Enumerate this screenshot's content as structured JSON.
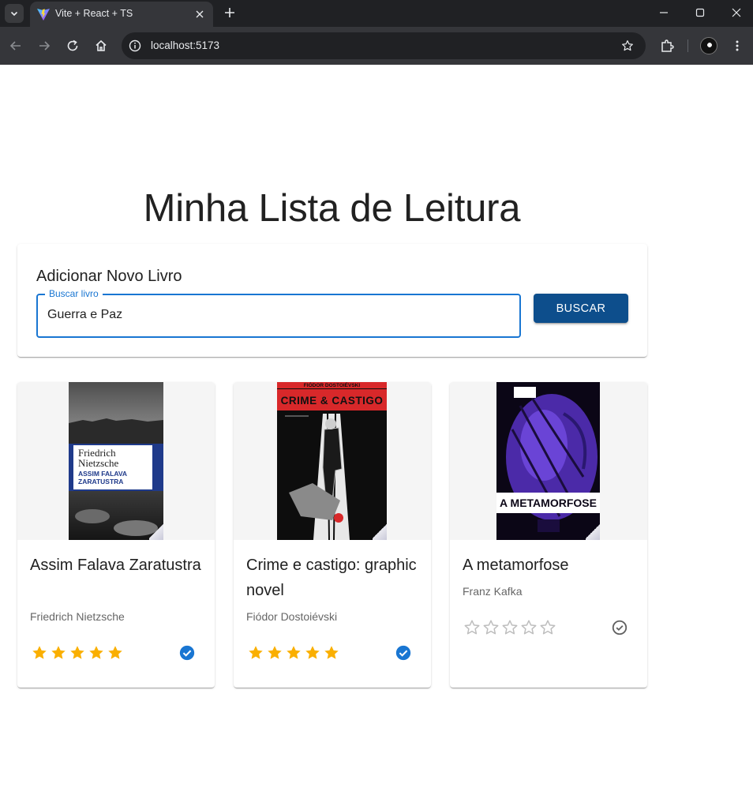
{
  "browser": {
    "tab_title": "Vite + React + TS",
    "url": "localhost:5173"
  },
  "page": {
    "title": "Minha Lista de Leitura"
  },
  "add_book": {
    "heading": "Adicionar Novo Livro",
    "search_label": "Buscar livro",
    "search_value": "Guerra e Paz",
    "button_label": "BUSCAR"
  },
  "books": [
    {
      "title": "Assim Falava Zaratustra",
      "author": "Friedrich Nietzsche",
      "rating": 5,
      "read": true,
      "cover_text": {
        "author": "Friedrich Nietzsche",
        "title": "ASSIM FALAVA ZARATUSTRA"
      }
    },
    {
      "title": "Crime e castigo: graphic novel",
      "author": "Fiódor Dostoiévski",
      "rating": 5,
      "read": true,
      "cover_text": {
        "author": "FIÓDOR DOSTOIÉVSKI",
        "title": "CRIME & CASTIGO"
      }
    },
    {
      "title": "A metamorfose",
      "author": "Franz Kafka",
      "rating": 0,
      "read": false,
      "cover_text": {
        "title": "A METAMORFOSE"
      }
    }
  ],
  "colors": {
    "primary": "#1976d2",
    "button": "#0d4e8c",
    "star_filled": "#faaf00",
    "star_empty": "#bdbdbd",
    "check_read": "#1976d2",
    "check_unread": "#616161"
  }
}
